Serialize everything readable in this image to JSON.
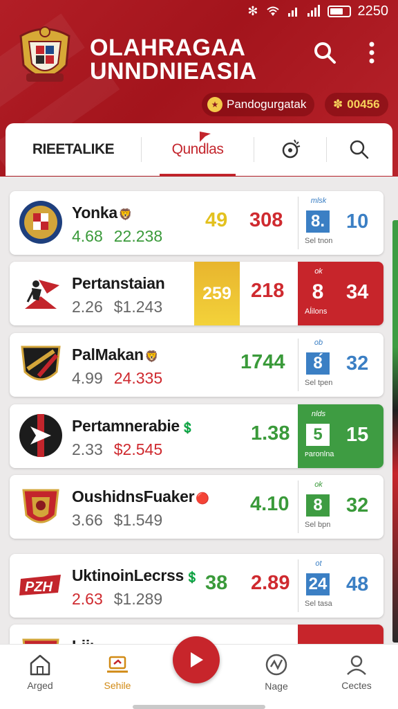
{
  "status_bar": {
    "time": "2250",
    "icons": [
      "bluetooth-icon",
      "wifi-icon",
      "signal-icon",
      "signal-icon",
      "battery-icon"
    ]
  },
  "header": {
    "title_line1": "OLAHRAGAA",
    "title_line2": "UNNDNIEASIA",
    "user_pill": "Pandogurgatak",
    "coins": "00456",
    "coin_prefix": "✽",
    "colors": {
      "primary": "#b21e26",
      "accent": "#f7d25a"
    }
  },
  "tabs": [
    {
      "label": "RIEETALIKE"
    },
    {
      "label": "Qundlas"
    }
  ],
  "cards": [
    {
      "name": "Yonka",
      "emoji": "🦁",
      "stat1": "4.68",
      "stat2": "22.238",
      "n1": "49",
      "n2": "308",
      "mini": "mlsk",
      "box": "8.",
      "cap": "Sel tnon",
      "big": "10"
    },
    {
      "name": "Pertanstaian",
      "stat1": "2.26",
      "stat2": "$1.243",
      "highlight": "259",
      "n2": "218",
      "mini": "ok",
      "box": "8",
      "cap": "Aĺilons",
      "big": "34"
    },
    {
      "name": "PalMakan",
      "emoji": "🦁",
      "stat1": "4.99",
      "stat2": "24.335",
      "n1": "1744",
      "mini": "ob",
      "box": "8́",
      "cap": "Sel tpen",
      "big": "32"
    },
    {
      "name": "Pertamnerabie",
      "emoji": "💲",
      "stat1": "2.33",
      "stat2": "$2.545",
      "n1": "1.38",
      "mini": "nlds",
      "box": "5",
      "cap": "ᴘаronlna",
      "big": "15"
    },
    {
      "name": "OushidnsFuaker",
      "emoji": "🔴",
      "stat1": "3.66",
      "stat2": "$1.549",
      "n1": "4.10",
      "mini": "ok",
      "box": "8",
      "cap": "Sel bpn",
      "big": "32"
    },
    {
      "name": "UktinoinLecrss",
      "emoji": "💲",
      "stat1": "2.63",
      "stat2": "$1.289",
      "n1": "38",
      "n2": "2.89",
      "mini": "ot",
      "box": "24",
      "cap": "Sel tasa",
      "big": "48"
    },
    {
      "name": "Liiı"
    }
  ],
  "bottom_nav": [
    {
      "label": "Arged",
      "icon": "home-icon"
    },
    {
      "label": "Sehile",
      "icon": "laptop-icon"
    },
    {
      "label": "Nage",
      "icon": "activity-icon"
    },
    {
      "label": "Cectes",
      "icon": "user-icon"
    }
  ]
}
